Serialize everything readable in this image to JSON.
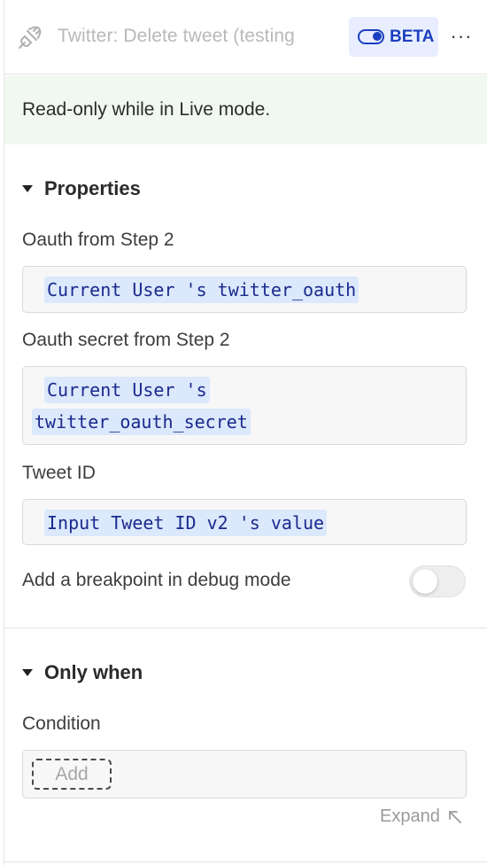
{
  "header": {
    "title": "Twitter: Delete tweet (testing",
    "beta_label": "BETA",
    "more_label": "···",
    "icon": "plug-off-icon"
  },
  "notice": {
    "text": "Read-only while in Live mode."
  },
  "properties": {
    "title": "Properties",
    "fields": [
      {
        "label": "Oauth from Step 2",
        "value": "Current User 's twitter_oauth"
      },
      {
        "label": "Oauth secret from Step 2",
        "value_line1": "Current User 's",
        "value_line2": "twitter_oauth_secret"
      },
      {
        "label": "Tweet ID",
        "value": "Input Tweet ID v2 's value"
      }
    ],
    "breakpoint_label": "Add a breakpoint in debug mode",
    "breakpoint_enabled": false
  },
  "only_when": {
    "title": "Only when",
    "condition_label": "Condition",
    "add_label": "Add",
    "expand_label": "Expand"
  },
  "colors": {
    "accent": "#1c3fbf",
    "chip_bg": "#dce8fb",
    "notice_bg": "#f1f8f2"
  }
}
